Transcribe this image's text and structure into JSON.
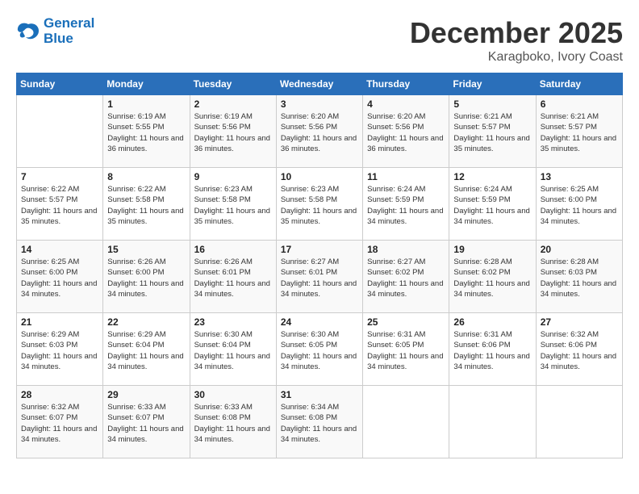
{
  "header": {
    "logo_line1": "General",
    "logo_line2": "Blue",
    "month": "December 2025",
    "location": "Karagboko, Ivory Coast"
  },
  "weekdays": [
    "Sunday",
    "Monday",
    "Tuesday",
    "Wednesday",
    "Thursday",
    "Friday",
    "Saturday"
  ],
  "weeks": [
    [
      {
        "day": "",
        "info": ""
      },
      {
        "day": "1",
        "info": "Sunrise: 6:19 AM\nSunset: 5:55 PM\nDaylight: 11 hours and 36 minutes."
      },
      {
        "day": "2",
        "info": "Sunrise: 6:19 AM\nSunset: 5:56 PM\nDaylight: 11 hours and 36 minutes."
      },
      {
        "day": "3",
        "info": "Sunrise: 6:20 AM\nSunset: 5:56 PM\nDaylight: 11 hours and 36 minutes."
      },
      {
        "day": "4",
        "info": "Sunrise: 6:20 AM\nSunset: 5:56 PM\nDaylight: 11 hours and 36 minutes."
      },
      {
        "day": "5",
        "info": "Sunrise: 6:21 AM\nSunset: 5:57 PM\nDaylight: 11 hours and 35 minutes."
      },
      {
        "day": "6",
        "info": "Sunrise: 6:21 AM\nSunset: 5:57 PM\nDaylight: 11 hours and 35 minutes."
      }
    ],
    [
      {
        "day": "7",
        "info": "Sunrise: 6:22 AM\nSunset: 5:57 PM\nDaylight: 11 hours and 35 minutes."
      },
      {
        "day": "8",
        "info": "Sunrise: 6:22 AM\nSunset: 5:58 PM\nDaylight: 11 hours and 35 minutes."
      },
      {
        "day": "9",
        "info": "Sunrise: 6:23 AM\nSunset: 5:58 PM\nDaylight: 11 hours and 35 minutes."
      },
      {
        "day": "10",
        "info": "Sunrise: 6:23 AM\nSunset: 5:58 PM\nDaylight: 11 hours and 35 minutes."
      },
      {
        "day": "11",
        "info": "Sunrise: 6:24 AM\nSunset: 5:59 PM\nDaylight: 11 hours and 34 minutes."
      },
      {
        "day": "12",
        "info": "Sunrise: 6:24 AM\nSunset: 5:59 PM\nDaylight: 11 hours and 34 minutes."
      },
      {
        "day": "13",
        "info": "Sunrise: 6:25 AM\nSunset: 6:00 PM\nDaylight: 11 hours and 34 minutes."
      }
    ],
    [
      {
        "day": "14",
        "info": "Sunrise: 6:25 AM\nSunset: 6:00 PM\nDaylight: 11 hours and 34 minutes."
      },
      {
        "day": "15",
        "info": "Sunrise: 6:26 AM\nSunset: 6:00 PM\nDaylight: 11 hours and 34 minutes."
      },
      {
        "day": "16",
        "info": "Sunrise: 6:26 AM\nSunset: 6:01 PM\nDaylight: 11 hours and 34 minutes."
      },
      {
        "day": "17",
        "info": "Sunrise: 6:27 AM\nSunset: 6:01 PM\nDaylight: 11 hours and 34 minutes."
      },
      {
        "day": "18",
        "info": "Sunrise: 6:27 AM\nSunset: 6:02 PM\nDaylight: 11 hours and 34 minutes."
      },
      {
        "day": "19",
        "info": "Sunrise: 6:28 AM\nSunset: 6:02 PM\nDaylight: 11 hours and 34 minutes."
      },
      {
        "day": "20",
        "info": "Sunrise: 6:28 AM\nSunset: 6:03 PM\nDaylight: 11 hours and 34 minutes."
      }
    ],
    [
      {
        "day": "21",
        "info": "Sunrise: 6:29 AM\nSunset: 6:03 PM\nDaylight: 11 hours and 34 minutes."
      },
      {
        "day": "22",
        "info": "Sunrise: 6:29 AM\nSunset: 6:04 PM\nDaylight: 11 hours and 34 minutes."
      },
      {
        "day": "23",
        "info": "Sunrise: 6:30 AM\nSunset: 6:04 PM\nDaylight: 11 hours and 34 minutes."
      },
      {
        "day": "24",
        "info": "Sunrise: 6:30 AM\nSunset: 6:05 PM\nDaylight: 11 hours and 34 minutes."
      },
      {
        "day": "25",
        "info": "Sunrise: 6:31 AM\nSunset: 6:05 PM\nDaylight: 11 hours and 34 minutes."
      },
      {
        "day": "26",
        "info": "Sunrise: 6:31 AM\nSunset: 6:06 PM\nDaylight: 11 hours and 34 minutes."
      },
      {
        "day": "27",
        "info": "Sunrise: 6:32 AM\nSunset: 6:06 PM\nDaylight: 11 hours and 34 minutes."
      }
    ],
    [
      {
        "day": "28",
        "info": "Sunrise: 6:32 AM\nSunset: 6:07 PM\nDaylight: 11 hours and 34 minutes."
      },
      {
        "day": "29",
        "info": "Sunrise: 6:33 AM\nSunset: 6:07 PM\nDaylight: 11 hours and 34 minutes."
      },
      {
        "day": "30",
        "info": "Sunrise: 6:33 AM\nSunset: 6:08 PM\nDaylight: 11 hours and 34 minutes."
      },
      {
        "day": "31",
        "info": "Sunrise: 6:34 AM\nSunset: 6:08 PM\nDaylight: 11 hours and 34 minutes."
      },
      {
        "day": "",
        "info": ""
      },
      {
        "day": "",
        "info": ""
      },
      {
        "day": "",
        "info": ""
      }
    ]
  ]
}
